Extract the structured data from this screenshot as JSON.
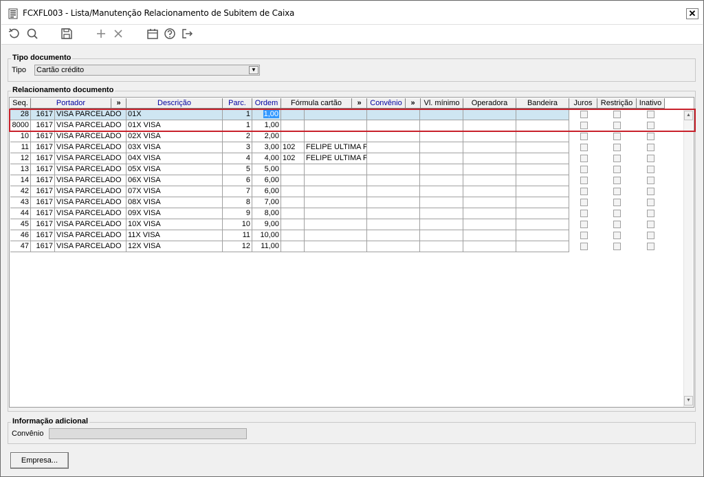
{
  "window": {
    "title": "FCXFL003 - Lista/Manutenção Relacionamento de Subitem de Caixa"
  },
  "toolbar": {
    "icons": [
      "refresh-icon",
      "search-icon",
      "save-icon",
      "add-icon",
      "delete-icon",
      "calendar-icon",
      "help-icon",
      "exit-icon"
    ]
  },
  "tipo_documento": {
    "group_label": "Tipo documento",
    "tipo_label": "Tipo",
    "tipo_value": "Cartão crédito"
  },
  "relacionamento": {
    "group_label": "Relacionamento documento",
    "columns": {
      "seq": "Seq.",
      "portador": "Portador",
      "more1": "»",
      "descricao": "Descrição",
      "parc": "Parc.",
      "ordem": "Ordem",
      "formula": "Fórmula cartão",
      "more2": "»",
      "convenio": "Convênio",
      "more3": "»",
      "vl_minimo": "Vl. mínimo",
      "operadora": "Operadora",
      "bandeira": "Bandeira",
      "juros": "Juros",
      "restricao": "Restrição",
      "inativo": "Inativo"
    },
    "rows": [
      {
        "seq": "28",
        "port_code": "1617",
        "port_name": "VISA PARCELADO",
        "descricao": "01X",
        "parc": "1",
        "ordem": "1,00",
        "formula_code": "",
        "formula_name": ""
      },
      {
        "seq": "8000",
        "port_code": "1617",
        "port_name": "VISA PARCELADO",
        "descricao": "01X VISA",
        "parc": "1",
        "ordem": "1,00",
        "formula_code": "",
        "formula_name": ""
      },
      {
        "seq": "10",
        "port_code": "1617",
        "port_name": "VISA PARCELADO",
        "descricao": "02X VISA",
        "parc": "2",
        "ordem": "2,00",
        "formula_code": "",
        "formula_name": ""
      },
      {
        "seq": "11",
        "port_code": "1617",
        "port_name": "VISA PARCELADO",
        "descricao": "03X VISA",
        "parc": "3",
        "ordem": "3,00",
        "formula_code": "102",
        "formula_name": "FELIPE ULTIMA PAI"
      },
      {
        "seq": "12",
        "port_code": "1617",
        "port_name": "VISA PARCELADO",
        "descricao": "04X VISA",
        "parc": "4",
        "ordem": "4,00",
        "formula_code": "102",
        "formula_name": "FELIPE ULTIMA PAI"
      },
      {
        "seq": "13",
        "port_code": "1617",
        "port_name": "VISA PARCELADO",
        "descricao": "05X VISA",
        "parc": "5",
        "ordem": "5,00",
        "formula_code": "",
        "formula_name": ""
      },
      {
        "seq": "14",
        "port_code": "1617",
        "port_name": "VISA PARCELADO",
        "descricao": "06X VISA",
        "parc": "6",
        "ordem": "6,00",
        "formula_code": "",
        "formula_name": ""
      },
      {
        "seq": "42",
        "port_code": "1617",
        "port_name": "VISA PARCELADO",
        "descricao": "07X VISA",
        "parc": "7",
        "ordem": "6,00",
        "formula_code": "",
        "formula_name": ""
      },
      {
        "seq": "43",
        "port_code": "1617",
        "port_name": "VISA PARCELADO",
        "descricao": "08X VISA",
        "parc": "8",
        "ordem": "7,00",
        "formula_code": "",
        "formula_name": ""
      },
      {
        "seq": "44",
        "port_code": "1617",
        "port_name": "VISA PARCELADO",
        "descricao": "09X VISA",
        "parc": "9",
        "ordem": "8,00",
        "formula_code": "",
        "formula_name": ""
      },
      {
        "seq": "45",
        "port_code": "1617",
        "port_name": "VISA PARCELADO",
        "descricao": "10X VISA",
        "parc": "10",
        "ordem": "9,00",
        "formula_code": "",
        "formula_name": ""
      },
      {
        "seq": "46",
        "port_code": "1617",
        "port_name": "VISA PARCELADO",
        "descricao": "11X VISA",
        "parc": "11",
        "ordem": "10,00",
        "formula_code": "",
        "formula_name": ""
      },
      {
        "seq": "47",
        "port_code": "1617",
        "port_name": "VISA PARCELADO",
        "descricao": "12X VISA",
        "parc": "12",
        "ordem": "11,00",
        "formula_code": "",
        "formula_name": ""
      }
    ]
  },
  "informacao_adicional": {
    "group_label": "Informação adicional",
    "convenio_label": "Convênio",
    "convenio_value": ""
  },
  "buttons": {
    "empresa": "Empresa..."
  },
  "colors": {
    "highlight_box": "#c8202a",
    "selected_row": "#cfe6f2",
    "selection": "#3399ff",
    "header_link": "#0000a0"
  }
}
